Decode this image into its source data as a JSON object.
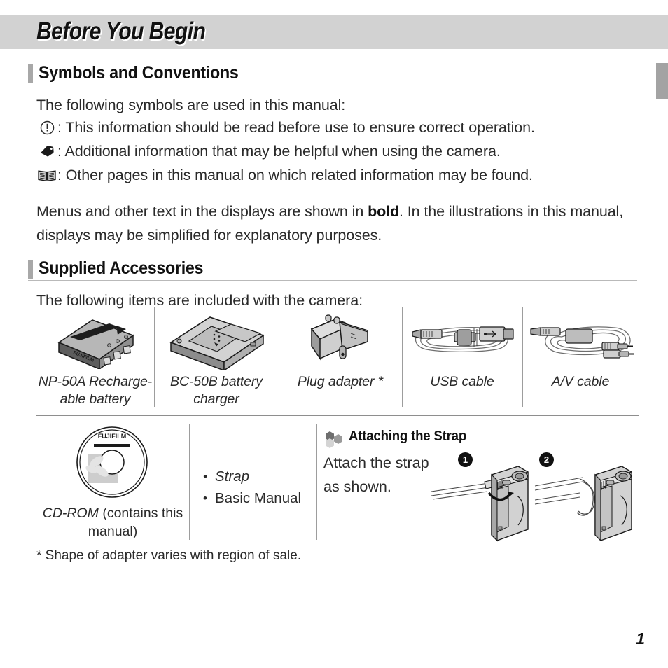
{
  "chapter": {
    "title": "Before You Begin"
  },
  "sections": {
    "symbols": {
      "heading": "Symbols and Conventions",
      "intro": "The following symbols are used in this manual:",
      "entries": [
        {
          "icon": "caution-circle-icon",
          "text": ": This information should be read before use to ensure correct operation."
        },
        {
          "icon": "note-tag-icon",
          "text": ": Additional information that may be helpful when using the camera."
        },
        {
          "icon": "open-book-icon",
          "text": ": Other pages in this manual on which related information may be found."
        }
      ],
      "paragraph_pre": "Menus and other text in the displays are shown in ",
      "paragraph_bold": "bold",
      "paragraph_post": ".  In the illustrations in this manual, displays may be simplified for explanatory purposes."
    },
    "accessories": {
      "heading": "Supplied Accessories",
      "intro": "The following items are included with the camera:",
      "items": [
        {
          "icon": "battery-icon",
          "caption_line1": "NP-50A Recharge-",
          "caption_line2": "able battery"
        },
        {
          "icon": "battery-charger-icon",
          "caption_line1": "BC-50B battery",
          "caption_line2": "charger"
        },
        {
          "icon": "plug-adapter-icon",
          "caption_line1": "Plug adapter *",
          "caption_line2": ""
        },
        {
          "icon": "usb-cable-icon",
          "caption_line1": "USB cable",
          "caption_line2": ""
        },
        {
          "icon": "av-cable-icon",
          "caption_line1": "A/V cable",
          "caption_line2": ""
        }
      ],
      "cd": {
        "icon": "cd-rom-icon",
        "disc_label": "FUJIFILM",
        "caption_italic": "CD-ROM",
        "caption_rest": " (contains this manual)"
      },
      "extra_items": [
        {
          "label": "Strap",
          "italic": true
        },
        {
          "label": "Basic Manual",
          "italic": false
        }
      ],
      "footnote": "* Shape of adapter varies with region of sale."
    },
    "strap": {
      "icon": "hexagons-icon",
      "title": "Attaching the Strap",
      "text_line1": "Attach the strap",
      "text_line2": "as shown.",
      "step1_badge": "1",
      "step2_badge": "2"
    }
  },
  "footer": {
    "page_number": "1"
  },
  "colors": {
    "band": "#d2d2d2",
    "tab_marker": "#a3a3a3",
    "heading_bar": "#a8a8a8",
    "rule": "#8e8e8e",
    "text": "#2a2a2a"
  }
}
